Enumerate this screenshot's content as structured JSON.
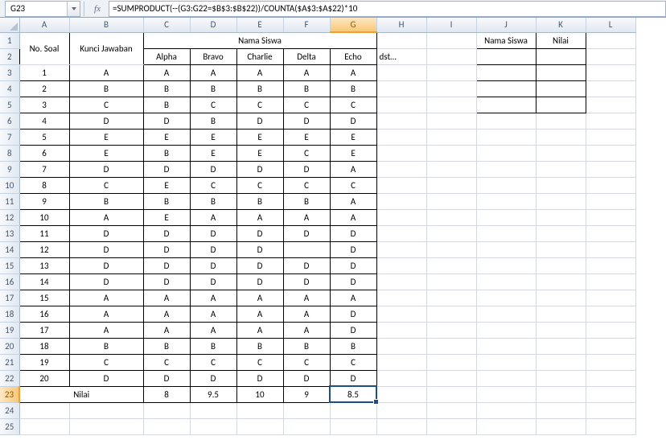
{
  "name_box": "G23",
  "formula": "=SUMPRODUCT(--(G3:G22=$B$3:$B$22))/COUNTA($A$3:$A$22)*10",
  "columns": [
    "A",
    "B",
    "C",
    "D",
    "E",
    "F",
    "G",
    "H",
    "I",
    "J",
    "K",
    "L"
  ],
  "selected_col": "G",
  "selected_row": 23,
  "hdr": {
    "no_soal": "No. Soal",
    "kunci": "Kunci Jawaban",
    "nama_siswa": "Nama Siswa",
    "dst": "dst…",
    "nilai": "Nilai"
  },
  "students": [
    "Alpha",
    "Bravo",
    "Charlie",
    "Delta",
    "Echo"
  ],
  "side": {
    "nama_siswa": "Nama Siswa",
    "nilai": "Nilai"
  },
  "rows": [
    {
      "n": "1",
      "k": "A",
      "a": [
        "A",
        "A",
        "A",
        "A",
        "A"
      ]
    },
    {
      "n": "2",
      "k": "B",
      "a": [
        "B",
        "B",
        "B",
        "B",
        "B"
      ]
    },
    {
      "n": "3",
      "k": "C",
      "a": [
        "B",
        "C",
        "C",
        "C",
        "C"
      ]
    },
    {
      "n": "4",
      "k": "D",
      "a": [
        "D",
        "B",
        "D",
        "D",
        "D"
      ]
    },
    {
      "n": "5",
      "k": "E",
      "a": [
        "E",
        "E",
        "E",
        "E",
        "E"
      ]
    },
    {
      "n": "6",
      "k": "E",
      "a": [
        "B",
        "E",
        "E",
        "C",
        "E"
      ]
    },
    {
      "n": "7",
      "k": "D",
      "a": [
        "D",
        "D",
        "D",
        "D",
        "A"
      ]
    },
    {
      "n": "8",
      "k": "C",
      "a": [
        "E",
        "C",
        "C",
        "C",
        "C"
      ]
    },
    {
      "n": "9",
      "k": "B",
      "a": [
        "B",
        "B",
        "B",
        "B",
        "A"
      ]
    },
    {
      "n": "10",
      "k": "A",
      "a": [
        "E",
        "A",
        "A",
        "A",
        "A"
      ]
    },
    {
      "n": "11",
      "k": "D",
      "a": [
        "D",
        "D",
        "D",
        "D",
        "D"
      ]
    },
    {
      "n": "12",
      "k": "D",
      "a": [
        "D",
        "D",
        "D",
        "",
        "D"
      ]
    },
    {
      "n": "13",
      "k": "D",
      "a": [
        "D",
        "D",
        "D",
        "D",
        "D"
      ]
    },
    {
      "n": "14",
      "k": "D",
      "a": [
        "D",
        "D",
        "D",
        "D",
        "D"
      ]
    },
    {
      "n": "15",
      "k": "A",
      "a": [
        "A",
        "A",
        "A",
        "A",
        "A"
      ]
    },
    {
      "n": "16",
      "k": "A",
      "a": [
        "A",
        "A",
        "A",
        "A",
        "D"
      ]
    },
    {
      "n": "17",
      "k": "A",
      "a": [
        "A",
        "A",
        "A",
        "A",
        "D"
      ]
    },
    {
      "n": "18",
      "k": "B",
      "a": [
        "B",
        "B",
        "B",
        "B",
        "B"
      ]
    },
    {
      "n": "19",
      "k": "C",
      "a": [
        "C",
        "C",
        "C",
        "C",
        "C"
      ]
    },
    {
      "n": "20",
      "k": "D",
      "a": [
        "D",
        "D",
        "D",
        "D",
        "D"
      ]
    }
  ],
  "nilai_row": {
    "label": "Nilai",
    "vals": [
      "8",
      "9.5",
      "10",
      "9",
      "8.5"
    ]
  }
}
